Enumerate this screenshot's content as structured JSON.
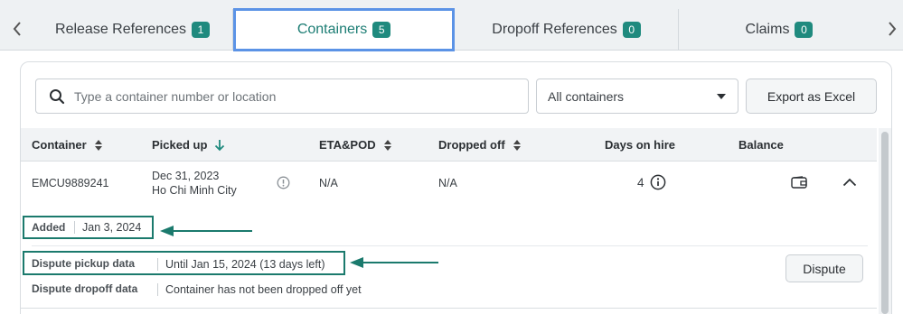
{
  "tabs": [
    {
      "label": "Release References",
      "count": "1"
    },
    {
      "label": "Containers",
      "count": "5"
    },
    {
      "label": "Dropoff References",
      "count": "0"
    },
    {
      "label": "Claims",
      "count": "0"
    }
  ],
  "toolbar": {
    "search_placeholder": "Type a container number or location",
    "filter_value": "All containers",
    "export_label": "Export as Excel"
  },
  "table": {
    "columns": [
      "Container",
      "Picked up",
      "ETA&POD",
      "Dropped off",
      "Days on hire",
      "Balance"
    ],
    "rows": [
      {
        "container": "EMCU9889241",
        "picked_up_date": "Dec 31, 2023",
        "picked_up_location": "Ho Chi Minh City",
        "eta_pod": "N/A",
        "dropped_off": "N/A",
        "days_on_hire": "4"
      }
    ]
  },
  "details": {
    "added_label": "Added",
    "added_value": "Jan 3, 2024",
    "dispute_pickup_label": "Dispute pickup data",
    "dispute_pickup_value": "Until Jan 15, 2024 (13 days left)",
    "dispute_dropoff_label": "Dispute dropoff data",
    "dispute_dropoff_value": "Container has not been dropped off yet",
    "dispute_button": "Dispute"
  },
  "colors": {
    "accent": "#1f8a7e",
    "highlight": "#1b7a6d",
    "active_tab_border": "#5b93e6"
  }
}
